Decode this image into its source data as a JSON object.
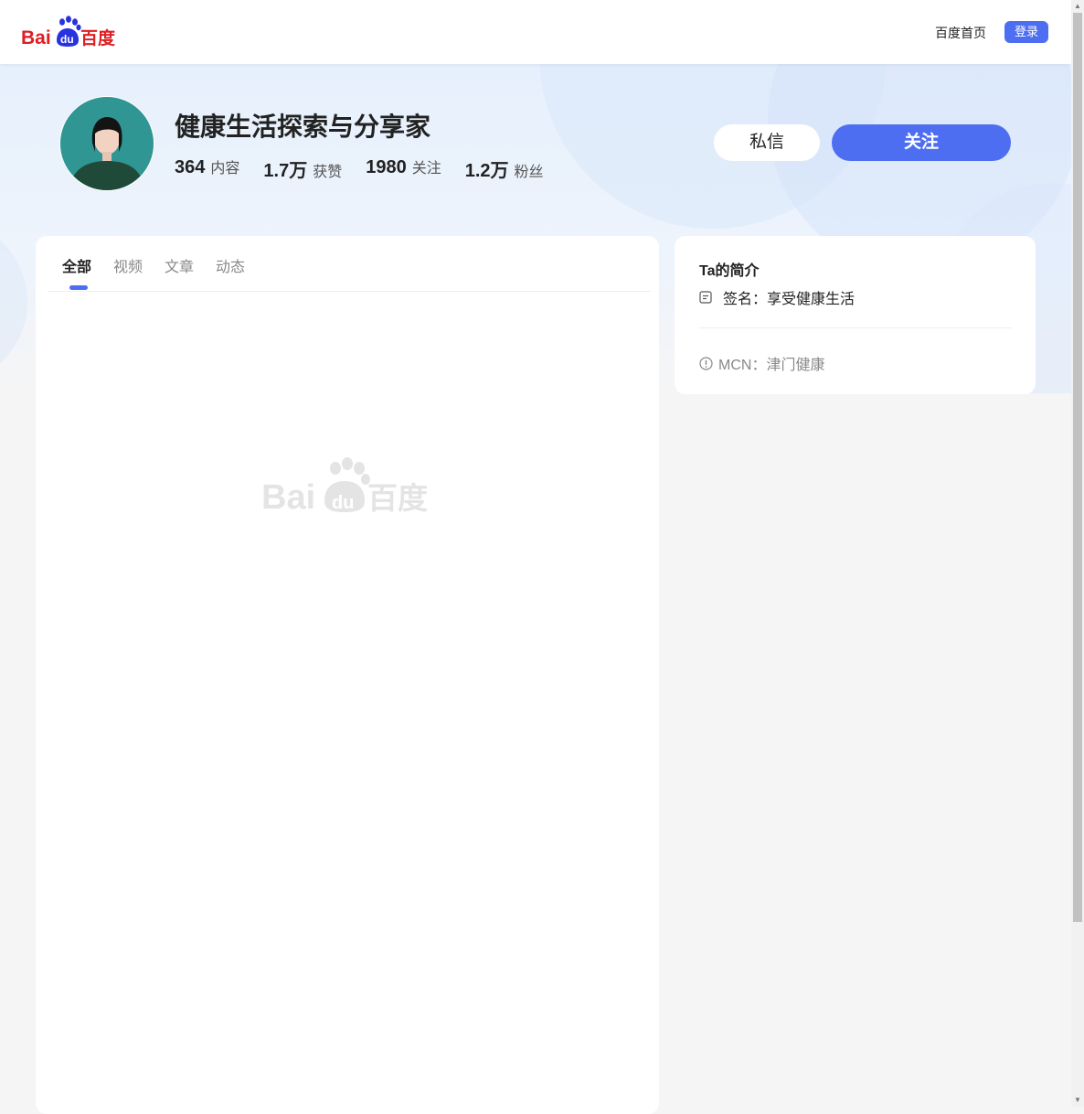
{
  "header": {
    "logo_text": "Bai du 百度",
    "nav_home": "百度首页",
    "login": "登录"
  },
  "profile": {
    "name": "健康生活探索与分享家",
    "stats": [
      {
        "num": "364",
        "label": "内容"
      },
      {
        "num": "1.7万",
        "label": "获赞"
      },
      {
        "num": "1980",
        "label": "关注"
      },
      {
        "num": "1.2万",
        "label": "粉丝"
      }
    ],
    "message_button": "私信",
    "follow_button": "关注"
  },
  "tabs": [
    {
      "label": "全部",
      "active": true
    },
    {
      "label": "视频",
      "active": false
    },
    {
      "label": "文章",
      "active": false
    },
    {
      "label": "动态",
      "active": false
    }
  ],
  "intro": {
    "title": "Ta的简介",
    "signature": "签名：享受健康生活",
    "mcn": "MCN：津门健康"
  },
  "colors": {
    "brand_blue": "#4e6ef2",
    "baidu_red": "#de1f24",
    "baidu_blue": "#2932e1"
  }
}
